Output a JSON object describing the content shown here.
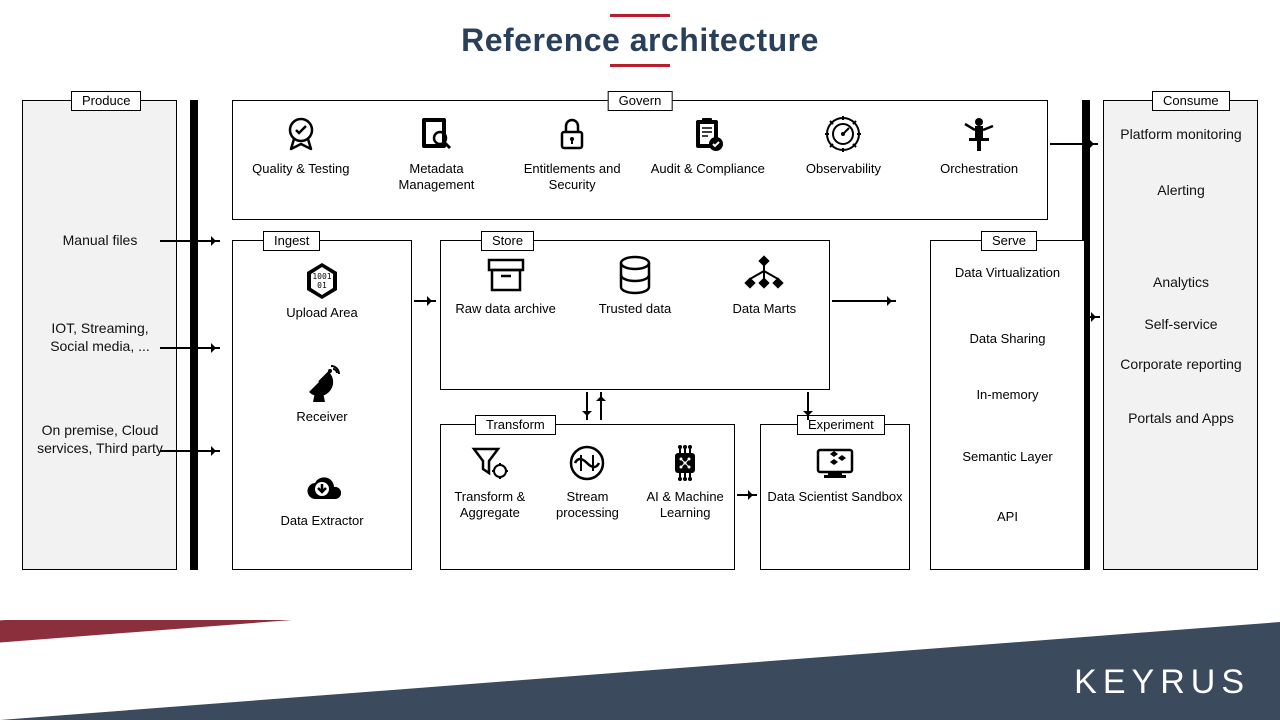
{
  "title": "Reference architecture",
  "footer_logo": "KEYRUS",
  "produce": {
    "label": "Produce",
    "items": [
      "Manual files",
      "IOT, Streaming, Social media, ...",
      "On premise, Cloud services, Third party"
    ]
  },
  "consume": {
    "label": "Consume",
    "items": [
      "Platform monitoring",
      "Alerting",
      "Analytics",
      "Self-service",
      "Corporate reporting",
      "Portals and Apps"
    ]
  },
  "govern": {
    "label": "Govern",
    "items": [
      "Quality & Testing",
      "Metadata Management",
      "Entitlements and Security",
      "Audit & Compliance",
      "Observability",
      "Orchestration"
    ]
  },
  "ingest": {
    "label": "Ingest",
    "items": [
      "Upload Area",
      "Receiver",
      "Data Extractor"
    ]
  },
  "store": {
    "label": "Store",
    "items": [
      "Raw data archive",
      "Trusted data",
      "Data Marts"
    ]
  },
  "transform": {
    "label": "Transform",
    "items": [
      "Transform & Aggregate",
      "Stream processing",
      "AI & Machine Learning"
    ]
  },
  "experiment": {
    "label": "Experiment",
    "items": [
      "Data Scientist Sandbox"
    ]
  },
  "serve": {
    "label": "Serve",
    "items": [
      "Data Virtualization",
      "Data Sharing",
      "In-memory",
      "Semantic Layer",
      "API"
    ]
  }
}
